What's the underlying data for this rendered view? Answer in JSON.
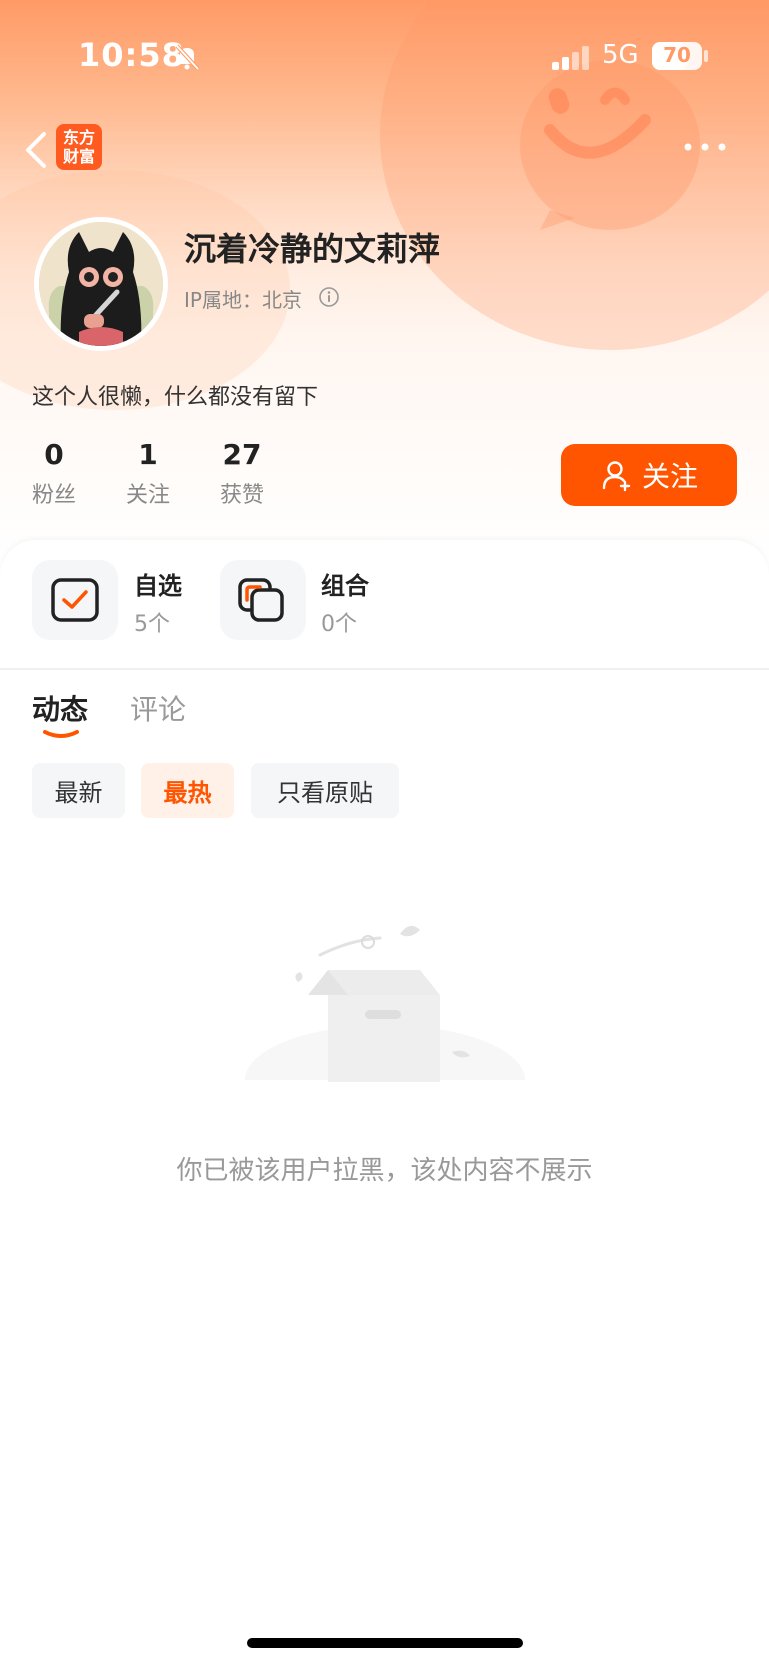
{
  "status_bar": {
    "time": "10:58",
    "network": "5G",
    "battery": "70",
    "battery_level_percent": 70
  },
  "nav": {
    "brand_logo": "东方财富",
    "back_icon": "chevron-left-icon",
    "more_icon": "more-horizontal-icon"
  },
  "profile": {
    "username": "沉着冷静的文莉萍",
    "ip_location": "IP属地：北京",
    "bio": "这个人很懒，什么都没有留下",
    "stats": [
      {
        "value": "0",
        "label": "粉丝"
      },
      {
        "value": "1",
        "label": "关注"
      },
      {
        "value": "27",
        "label": "获赞"
      }
    ],
    "follow_label": "关注"
  },
  "features": [
    {
      "title": "自选",
      "count": "5个",
      "icon": "watchlist-check-icon"
    },
    {
      "title": "组合",
      "count": "0个",
      "icon": "portfolio-icon"
    }
  ],
  "tabs": [
    {
      "label": "动态",
      "active": true
    },
    {
      "label": "评论",
      "active": false
    }
  ],
  "filters": [
    {
      "label": "最新",
      "active": false
    },
    {
      "label": "最热",
      "active": true
    },
    {
      "label": "只看原贴",
      "active": false
    }
  ],
  "empty_state": {
    "message": "你已被该用户拉黑，该处内容不展示",
    "icon": "empty-box-icon"
  },
  "colors": {
    "accent": "#ff5500",
    "header_gradient_top": "#ff9a66",
    "muted_text": "#999999"
  }
}
